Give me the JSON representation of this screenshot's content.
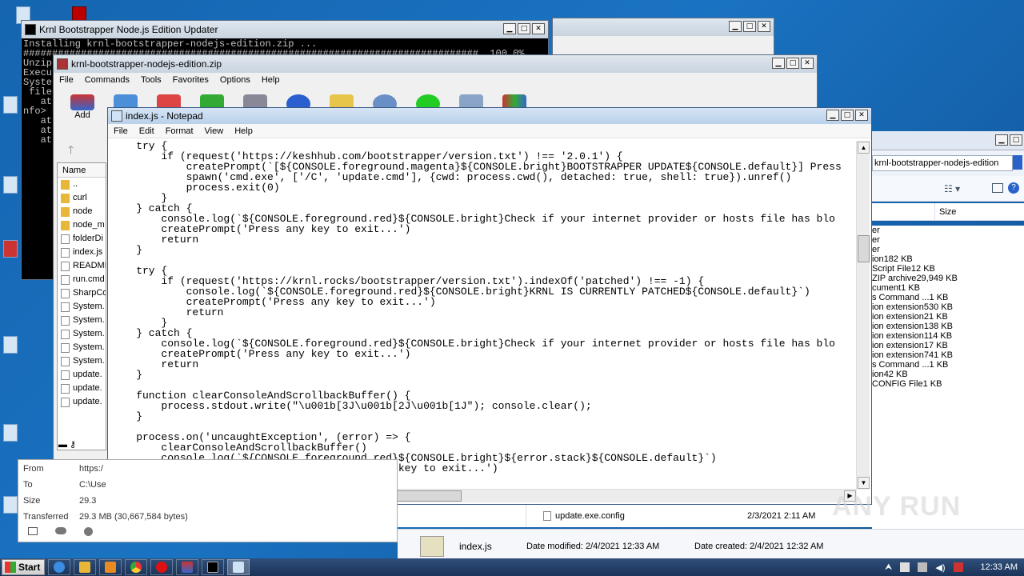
{
  "console": {
    "title": "Krnl Bootstrapper Node.js Edition Updater",
    "lines": [
      "Installing krnl-bootstrapper-nodejs-edition.zip ...",
      "###############################################################################  100.0%",
      "Unzip",
      "Execu",
      "Syste",
      " file",
      "   at",
      "nfo>",
      "   at",
      "   at",
      "   at"
    ]
  },
  "bg_window_controls": "▁ □ ✕",
  "winrar": {
    "title": "krnl-bootstrapper-nodejs-edition.zip",
    "menu": [
      "File",
      "Commands",
      "Tools",
      "Favorites",
      "Options",
      "Help"
    ],
    "add_label": "Add",
    "column_name": "Name",
    "files": [
      {
        "name": "..",
        "kind": "folder"
      },
      {
        "name": "curl",
        "kind": "folder"
      },
      {
        "name": "node",
        "kind": "folder"
      },
      {
        "name": "node_m",
        "kind": "folder"
      },
      {
        "name": "folderDi",
        "kind": "file"
      },
      {
        "name": "index.js",
        "kind": "file"
      },
      {
        "name": "README",
        "kind": "file"
      },
      {
        "name": "run.cmd",
        "kind": "file"
      },
      {
        "name": "SharpCo",
        "kind": "file"
      },
      {
        "name": "System.",
        "kind": "file"
      },
      {
        "name": "System.",
        "kind": "file"
      },
      {
        "name": "System.",
        "kind": "file"
      },
      {
        "name": "System.",
        "kind": "file"
      },
      {
        "name": "System.",
        "kind": "file"
      },
      {
        "name": "update.",
        "kind": "file"
      },
      {
        "name": "update.",
        "kind": "file"
      },
      {
        "name": "update.",
        "kind": "file"
      }
    ]
  },
  "notepad": {
    "title": "index.js - Notepad",
    "menu": [
      "File",
      "Edit",
      "Format",
      "View",
      "Help"
    ],
    "code": "    try {\n        if (request('https://keshhub.com/bootstrapper/version.txt') !== '2.0.1') {\n            createPrompt(`[${CONSOLE.foreground.magenta}${CONSOLE.bright}BOOTSTRAPPER UPDATE${CONSOLE.default}] Press\n            spawn('cmd.exe', ['/C', 'update.cmd'], {cwd: process.cwd(), detached: true, shell: true}).unref()\n            process.exit(0)\n        }\n    } catch {\n        console.log(`${CONSOLE.foreground.red}${CONSOLE.bright}Check if your internet provider or hosts file has blo\n        createPrompt('Press any key to exit...')\n        return\n    }\n\n    try {\n        if (request('https://krnl.rocks/bootstrapper/version.txt').indexOf('patched') !== -1) {\n            console.log(`${CONSOLE.foreground.red}${CONSOLE.bright}KRNL IS CURRENTLY PATCHED${CONSOLE.default}`)\n            createPrompt('Press any key to exit...')\n            return\n        }\n    } catch {\n        console.log(`${CONSOLE.foreground.red}${CONSOLE.bright}Check if your internet provider or hosts file has blo\n        createPrompt('Press any key to exit...')\n        return\n    }\n\n    function clearConsoleAndScrollbackBuffer() {\n        process.stdout.write(\"\\u001b[3J\\u001b[2J\\u001b[1J\"); console.clear();\n    }\n\n    process.on('uncaughtException', (error) => {\n        clearConsoleAndScrollbackBuffer()\n        console.log(`${CONSOLE.foreground.red}${CONSOLE.bright}${error.stack}${CONSOLE.default}`)\n        createPrompt('Error caught! Press any key to exit...')\n        process.exit()"
  },
  "explorer": {
    "path": "krnl-bootstrapper-nodejs-edition",
    "column_size": "Size",
    "rows": [
      {
        "type": "er",
        "size": ""
      },
      {
        "type": "er",
        "size": ""
      },
      {
        "type": "er",
        "size": ""
      },
      {
        "type": "ion",
        "size": "182 KB"
      },
      {
        "type": "Script File",
        "size": "12 KB",
        "selected": true
      },
      {
        "type": "ZIP archive",
        "size": "29,949 KB"
      },
      {
        "type": "cument",
        "size": "1 KB"
      },
      {
        "type": "s Command ...",
        "size": "1 KB"
      },
      {
        "type": "ion extension",
        "size": "530 KB"
      },
      {
        "type": "ion extension",
        "size": "21 KB"
      },
      {
        "type": "ion extension",
        "size": "138 KB"
      },
      {
        "type": "ion extension",
        "size": "114 KB"
      },
      {
        "type": "ion extension",
        "size": "17 KB"
      },
      {
        "type": "ion extension",
        "size": "741 KB"
      },
      {
        "type": "s Command ...",
        "size": "1 KB"
      },
      {
        "type": "ion",
        "size": "42 KB"
      },
      {
        "type": "CONFIG File",
        "size": "1 KB"
      }
    ],
    "update_config": {
      "name": "update.exe.config",
      "date": "2/3/2021 2:11 AM"
    }
  },
  "details": {
    "file_name": "index.js",
    "date_modified": "Date modified: 2/4/2021 12:33 AM",
    "date_created": "Date created: 2/4/2021 12:32 AM"
  },
  "download": {
    "from_label": "From",
    "from_value": "https:/",
    "to_label": "To",
    "to_value": "C:\\Use",
    "size_label": "Size",
    "size_value": "29.3",
    "transferred_label": "Transferred",
    "transferred_value": "29.3 MB (30,667,584 bytes)"
  },
  "taskbar": {
    "start_label": "Start",
    "clock": "12:33 AM"
  },
  "watermark": "ANY RUN"
}
